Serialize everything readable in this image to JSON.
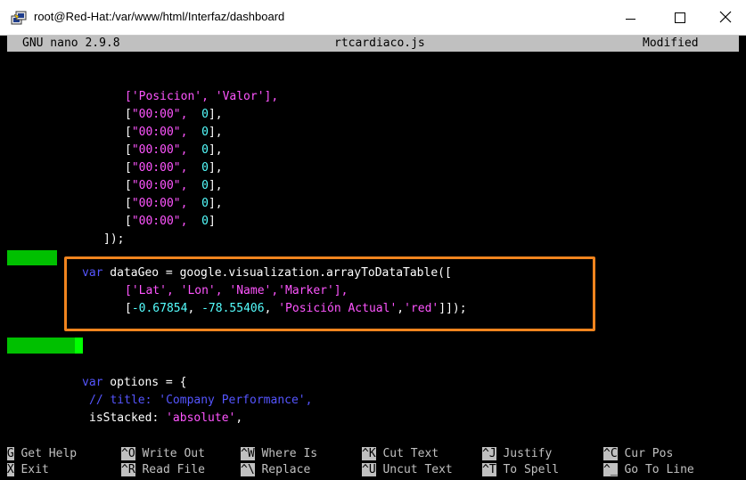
{
  "window": {
    "title": "root@Red-Hat:/var/www/html/Interfaz/dashboard",
    "app_icon": "putty-icon",
    "controls": [
      "minimize-icon",
      "maximize-icon",
      "close-icon"
    ]
  },
  "nano": {
    "version": "GNU nano 2.9.8",
    "filename": "rtcardiaco.js",
    "status": "Modified"
  },
  "code": {
    "l1_a": "['Posicion', 'Valor'],",
    "row_time": "\"00:00\",",
    "row_val": "0",
    "bracket_open": "[",
    "row_end_comma": "],",
    "row_end_last": "]",
    "close_block": "]);",
    "geo_var": "var",
    "geo_rest": " dataGeo = google.visualization.arrayToDataTable([",
    "geo_headers": "['Lat', 'Lon', 'Name','Marker'],",
    "geo_open": "[",
    "geo_lat": "-0.67854",
    "geo_sep1": ", ",
    "geo_lon": "-78.55406",
    "geo_sep2": ", ",
    "geo_name": "'Posición Actual'",
    "geo_sep3": ",",
    "geo_marker": "'red'",
    "geo_close": "]]);",
    "opt_var": "var",
    "opt_rest": " options = {",
    "comment": "// title: 'Company Performance',",
    "stacked_key": "isStacked: ",
    "stacked_val": "'absolute'",
    "stacked_end": ","
  },
  "shortcuts": [
    {
      "key": "^G",
      "label": "Get Help"
    },
    {
      "key": "^O",
      "label": "Write Out"
    },
    {
      "key": "^W",
      "label": "Where Is"
    },
    {
      "key": "^K",
      "label": "Cut Text"
    },
    {
      "key": "^J",
      "label": "Justify"
    },
    {
      "key": "^C",
      "label": "Cur Pos"
    },
    {
      "key": "^X",
      "label": "Exit"
    },
    {
      "key": "^R",
      "label": "Read File"
    },
    {
      "key": "^\\",
      "label": "Replace"
    },
    {
      "key": "^U",
      "label": "Uncut Text"
    },
    {
      "key": "^T",
      "label": "To Spell"
    },
    {
      "key": "^_",
      "label": "Go To Line"
    }
  ],
  "colors": {
    "highlight_box": "#f0841e",
    "cursor_bar": "#00ff00"
  }
}
